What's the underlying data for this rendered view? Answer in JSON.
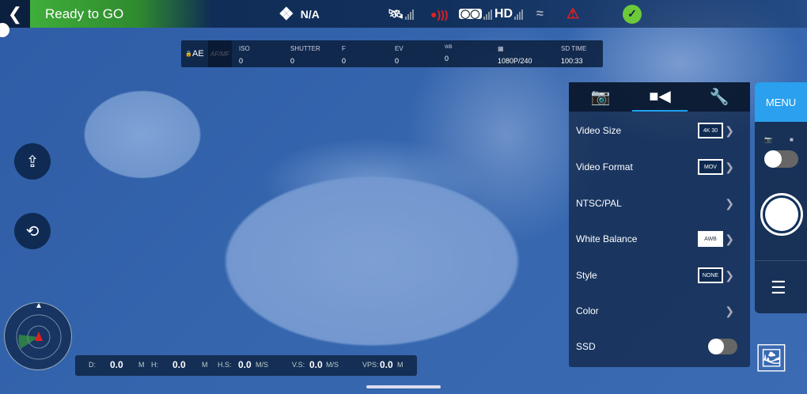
{
  "status": {
    "ready_text": "Ready to GO",
    "aircraft_text": "N/A"
  },
  "topbar_icons": [
    "back-icon",
    "drone-icon",
    "gps-satellite-icon",
    "remote-signal-icon",
    "controller-icon",
    "hd-signal-icon",
    "wifi-icon",
    "battery-warning-icon",
    "check-icon"
  ],
  "colors": {
    "accent": "#2aa0ef",
    "ready_green": "#3fae3a",
    "warning_red": "#e02020",
    "check_green": "#6cc93a"
  },
  "exposure": {
    "ae": "AE",
    "afmf": "AF/MF",
    "items": [
      {
        "label": "ISO",
        "value": "0"
      },
      {
        "label": "SHUTTER",
        "value": "0"
      },
      {
        "label": "F",
        "value": "0"
      },
      {
        "label": "EV",
        "value": "0"
      },
      {
        "label": "WB",
        "value": "0"
      },
      {
        "label": "",
        "value": "1080P/240"
      },
      {
        "label": "SD TIME",
        "value": "100:33"
      }
    ]
  },
  "hd_label": "HD",
  "telemetry": [
    {
      "label": "D:",
      "value": "0.0",
      "unit": "M"
    },
    {
      "label": "H:",
      "value": "0.0",
      "unit": "M"
    },
    {
      "label": "H.S:",
      "value": "0.0",
      "unit": "M/S"
    },
    {
      "label": "V.S:",
      "value": "0.0",
      "unit": "M/S"
    },
    {
      "label": "VPS:",
      "value": "0.0",
      "unit": "M"
    }
  ],
  "panel": {
    "rows": [
      {
        "label": "Video Size",
        "badge": "4K 30"
      },
      {
        "label": "Video Format",
        "badge": "MOV"
      },
      {
        "label": "NTSC/PAL",
        "badge": ""
      },
      {
        "label": "White Balance",
        "badge": "AWB"
      },
      {
        "label": "Style",
        "badge": "NONE"
      },
      {
        "label": "Color",
        "badge": ""
      },
      {
        "label": "SSD",
        "toggle": false
      }
    ]
  },
  "right": {
    "menu": "MENU",
    "mode": "photo"
  }
}
